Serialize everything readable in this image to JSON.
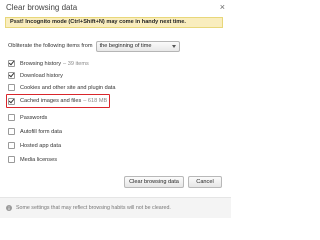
{
  "dialog": {
    "title": "Clear browsing data",
    "close_glyph": "×",
    "banner": "Psst! Incognito mode (Ctrl+Shift+N) may come in handy next time.",
    "obliterate_label": "Obliterate the following items from",
    "time_range": "the beginning of time",
    "options": [
      {
        "label": "Browsing history",
        "meta": "– 39 items",
        "checked": true
      },
      {
        "label": "Download history",
        "meta": "",
        "checked": true
      },
      {
        "label": "Cookies and other site and plugin data",
        "meta": "",
        "checked": false
      },
      {
        "label": "Cached images and files",
        "meta": "– 618 MB",
        "checked": true
      },
      {
        "label": "Passwords",
        "meta": "",
        "checked": false
      },
      {
        "label": "Autofill form data",
        "meta": "",
        "checked": false
      },
      {
        "label": "Hosted app data",
        "meta": "",
        "checked": false
      },
      {
        "label": "Media licenses",
        "meta": "",
        "checked": false
      }
    ],
    "clear_button": "Clear browsing data",
    "cancel_button": "Cancel",
    "footer_text": "Some settings that may reflect browsing habits will not be cleared.",
    "info_glyph": "i"
  },
  "colors": {
    "banner_bg": "#f9edbe",
    "highlight": "#d9262b"
  }
}
